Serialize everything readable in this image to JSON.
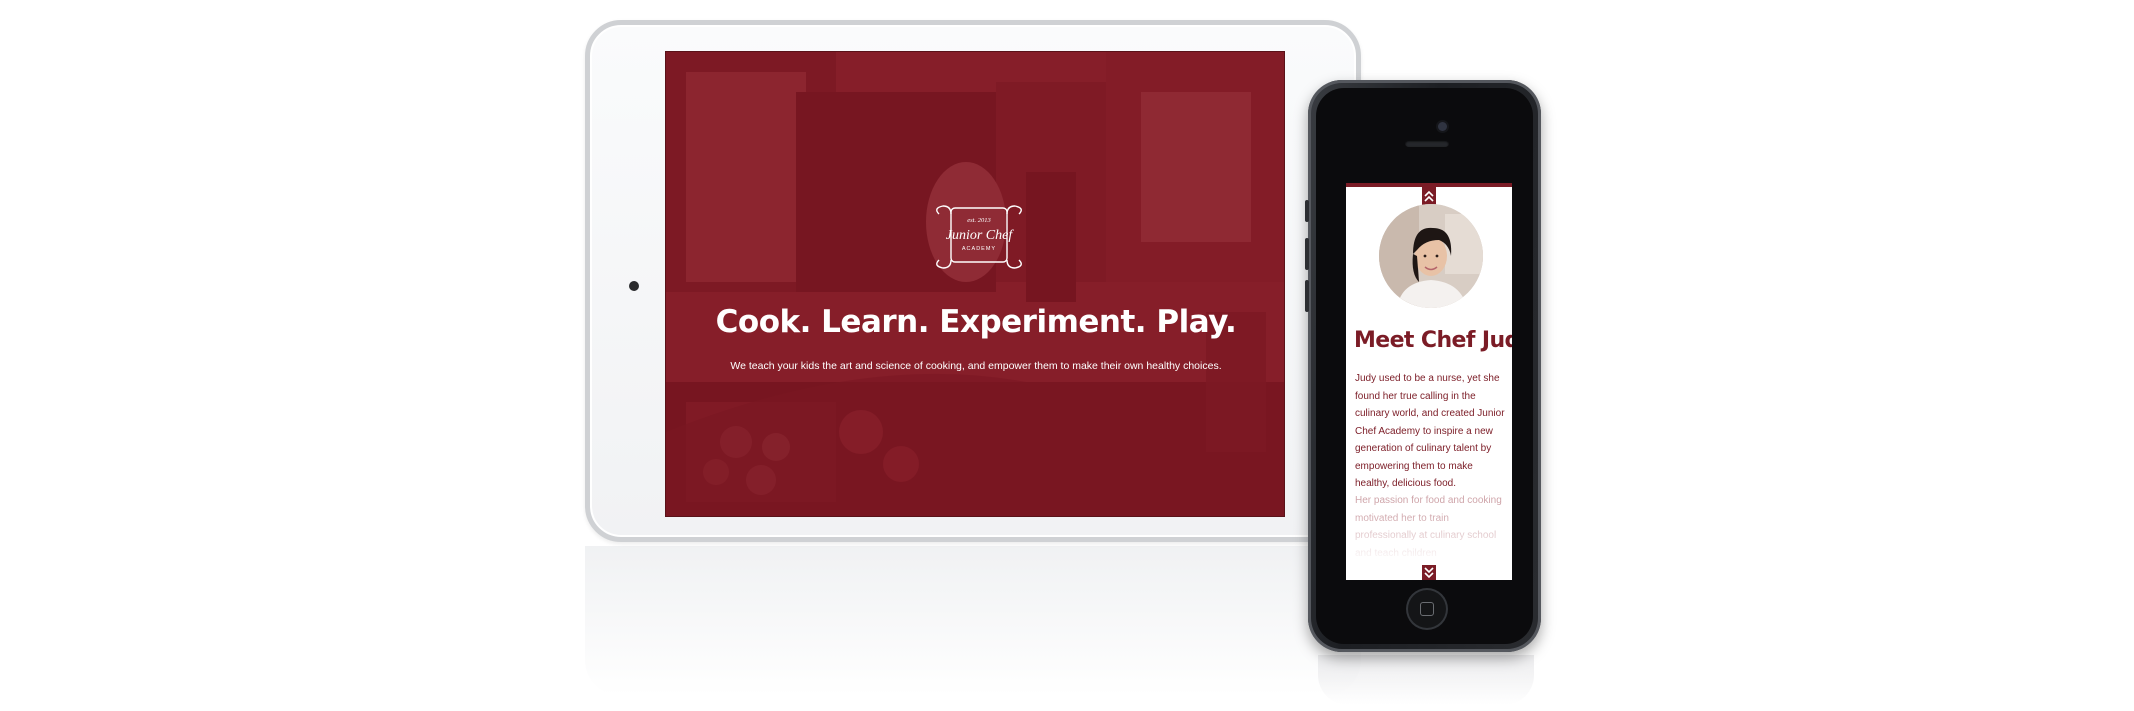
{
  "tablet": {
    "logo": {
      "est": "est. 2013",
      "name": "Junior Chef",
      "sub": "ACADEMY"
    },
    "headline": "Cook. Learn. Experiment. Play.",
    "subheadline": "We teach your kids the art and science of cooking, and empower them to make their own healthy choices."
  },
  "phone": {
    "heading": "Meet Chef Judy!",
    "paragraph": "Judy used to be a nurse, yet she found her true calling in the culinary world, and created Junior Chef Academy to inspire a new generation of culinary talent by empowering them to make healthy, delicious food.",
    "paragraph_faded": "Her passion for food and cooking motivated her to train professionally at culinary school and teach children"
  },
  "colors": {
    "brand_maroon": "#7b1c26",
    "faded_text": "#cfa5aa",
    "device_frame_white": "#f1f2f4",
    "device_frame_dark": "#1c1e22"
  },
  "icons": [
    "chevrons-up-icon",
    "chevrons-down-icon",
    "home-button-icon",
    "camera-icon"
  ]
}
